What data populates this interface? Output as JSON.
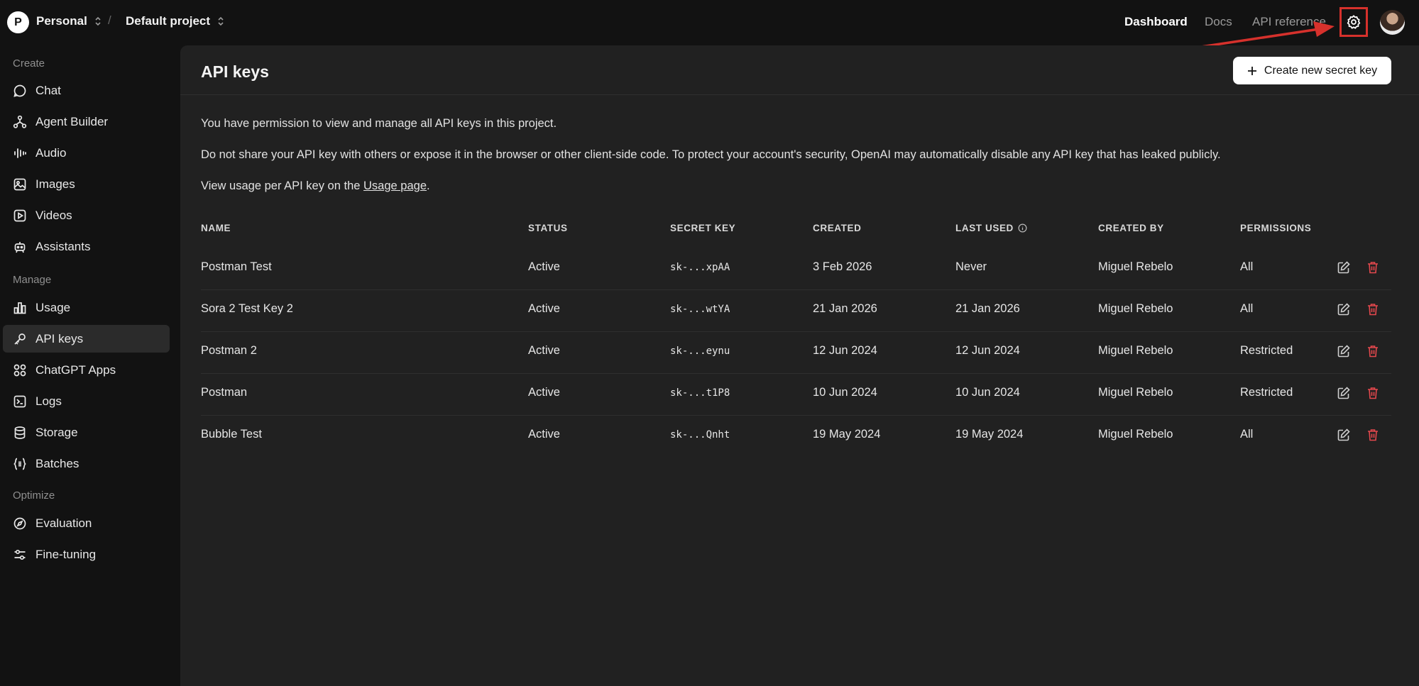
{
  "topbar": {
    "org_initial": "P",
    "org_name": "Personal",
    "separator": "/",
    "project_name": "Default project",
    "nav": [
      {
        "label": "Dashboard",
        "active": true
      },
      {
        "label": "Docs",
        "active": false
      },
      {
        "label": "API reference",
        "active": false
      }
    ],
    "settings_icon": "gear-icon",
    "highlight_color": "#d6312c"
  },
  "sidebar": {
    "sections": [
      {
        "title": "Create",
        "items": [
          {
            "label": "Chat",
            "icon": "chat-bubble-icon"
          },
          {
            "label": "Agent Builder",
            "icon": "agent-builder-icon"
          },
          {
            "label": "Audio",
            "icon": "audio-waveform-icon"
          },
          {
            "label": "Images",
            "icon": "image-icon"
          },
          {
            "label": "Videos",
            "icon": "video-play-icon"
          },
          {
            "label": "Assistants",
            "icon": "robot-icon"
          }
        ]
      },
      {
        "title": "Manage",
        "items": [
          {
            "label": "Usage",
            "icon": "bar-chart-icon"
          },
          {
            "label": "API keys",
            "icon": "key-icon",
            "active": true
          },
          {
            "label": "ChatGPT Apps",
            "icon": "apps-icon"
          },
          {
            "label": "Logs",
            "icon": "terminal-icon"
          },
          {
            "label": "Storage",
            "icon": "database-icon"
          },
          {
            "label": "Batches",
            "icon": "braces-icon"
          }
        ]
      },
      {
        "title": "Optimize",
        "items": [
          {
            "label": "Evaluation",
            "icon": "compass-icon"
          },
          {
            "label": "Fine-tuning",
            "icon": "sliders-icon"
          }
        ]
      }
    ]
  },
  "main": {
    "title": "API keys",
    "create_button": "Create new secret key",
    "info_1": "You have permission to view and manage all API keys in this project.",
    "info_2": "Do not share your API key with others or expose it in the browser or other client-side code. To protect your account's security, OpenAI may automatically disable any API key that has leaked publicly.",
    "info_3_prefix": "View usage per API key on the ",
    "info_3_link": "Usage page",
    "info_3_suffix": ".",
    "table": {
      "columns": [
        "NAME",
        "STATUS",
        "SECRET KEY",
        "CREATED",
        "LAST USED",
        "CREATED BY",
        "PERMISSIONS"
      ],
      "rows": [
        {
          "name": "Postman Test",
          "status": "Active",
          "secret_key": "sk-...xpAA",
          "created": "3 Feb 2026",
          "last_used": "Never",
          "created_by": "Miguel Rebelo",
          "permissions": "All"
        },
        {
          "name": "Sora 2 Test Key 2",
          "status": "Active",
          "secret_key": "sk-...wtYA",
          "created": "21 Jan 2026",
          "last_used": "21 Jan 2026",
          "created_by": "Miguel Rebelo",
          "permissions": "All"
        },
        {
          "name": "Postman 2",
          "status": "Active",
          "secret_key": "sk-...eynu",
          "created": "12 Jun 2024",
          "last_used": "12 Jun 2024",
          "created_by": "Miguel Rebelo",
          "permissions": "Restricted"
        },
        {
          "name": "Postman",
          "status": "Active",
          "secret_key": "sk-...t1P8",
          "created": "10 Jun 2024",
          "last_used": "10 Jun 2024",
          "created_by": "Miguel Rebelo",
          "permissions": "Restricted"
        },
        {
          "name": "Bubble Test",
          "status": "Active",
          "secret_key": "sk-...Qnht",
          "created": "19 May 2024",
          "last_used": "19 May 2024",
          "created_by": "Miguel Rebelo",
          "permissions": "All"
        }
      ]
    },
    "delete_color": "#e5484d"
  }
}
